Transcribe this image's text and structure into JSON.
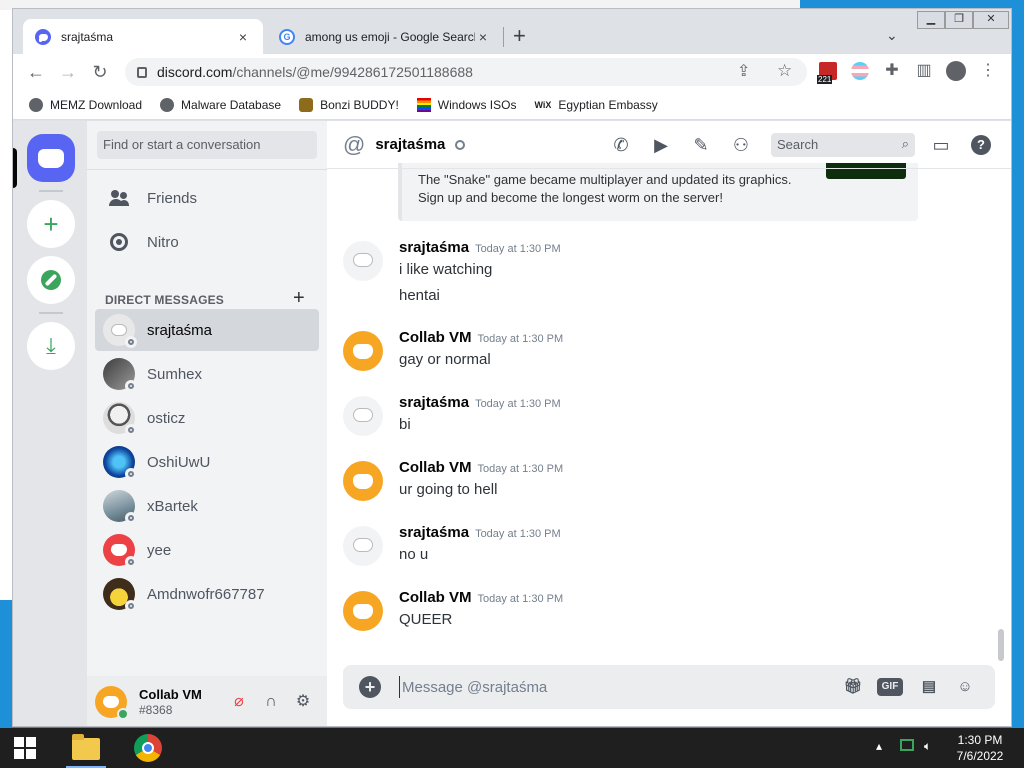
{
  "browser": {
    "tabs": [
      {
        "title": "srajtaśma",
        "close": "×"
      },
      {
        "title": "among us emoji - Google Search",
        "close": "×"
      }
    ],
    "new_tab": "+",
    "url_host": "discord.com",
    "url_path": "/channels/@me/994286172501188688",
    "extension_badge": "221",
    "bookmarks": [
      {
        "label": "MEMZ Download"
      },
      {
        "label": "Malware Database"
      },
      {
        "label": "Bonzi BUDDY!"
      },
      {
        "label": "Windows ISOs"
      },
      {
        "label": "Egyptian Embassy"
      }
    ],
    "wix_label": "WiX"
  },
  "discord": {
    "search_placeholder": "Find or start a conversation",
    "nav": [
      {
        "label": "Friends"
      },
      {
        "label": "Nitro"
      }
    ],
    "dm_header": "DIRECT MESSAGES",
    "dm_add": "+",
    "dms": [
      {
        "name": "srajtaśma",
        "selected": true
      },
      {
        "name": "Sumhex"
      },
      {
        "name": "osticz"
      },
      {
        "name": "OshiUwU"
      },
      {
        "name": "xBartek"
      },
      {
        "name": "yee"
      },
      {
        "name": "Amdnwofr667787"
      }
    ],
    "user": {
      "name": "Collab VM",
      "tag": "#8368"
    },
    "channel": {
      "name": "srajtaśma",
      "search": "Search"
    },
    "embed": {
      "text": "The \"Snake\" game became multiplayer and updated its graphics. Sign up and become the longest worm on the server!"
    },
    "messages": [
      {
        "author": "srajtaśma",
        "time": "Today at 1:30 PM",
        "lines": [
          "i like watching",
          "hentai"
        ]
      },
      {
        "author": "Collab VM",
        "time": "Today at 1:30 PM",
        "lines": [
          "gay or normal"
        ]
      },
      {
        "author": "srajtaśma",
        "time": "Today at 1:30 PM",
        "lines": [
          "bi"
        ]
      },
      {
        "author": "Collab VM",
        "time": "Today at 1:30 PM",
        "lines": [
          "ur going to hell"
        ]
      },
      {
        "author": "srajtaśma",
        "time": "Today at 1:30 PM",
        "lines": [
          "no u"
        ]
      },
      {
        "author": "Collab VM",
        "time": "Today at 1:30 PM",
        "lines": [
          "QUEER"
        ]
      }
    ],
    "composer_placeholder": "Message @srajtaśma",
    "gif_label": "GIF"
  },
  "taskbar": {
    "time": "1:30 PM",
    "date": "7/6/2022"
  },
  "colors": {
    "blurple": "#5865f2",
    "collab_orange": "#f6a623",
    "red_avatar": "#ed4245",
    "green": "#3ba55d"
  }
}
